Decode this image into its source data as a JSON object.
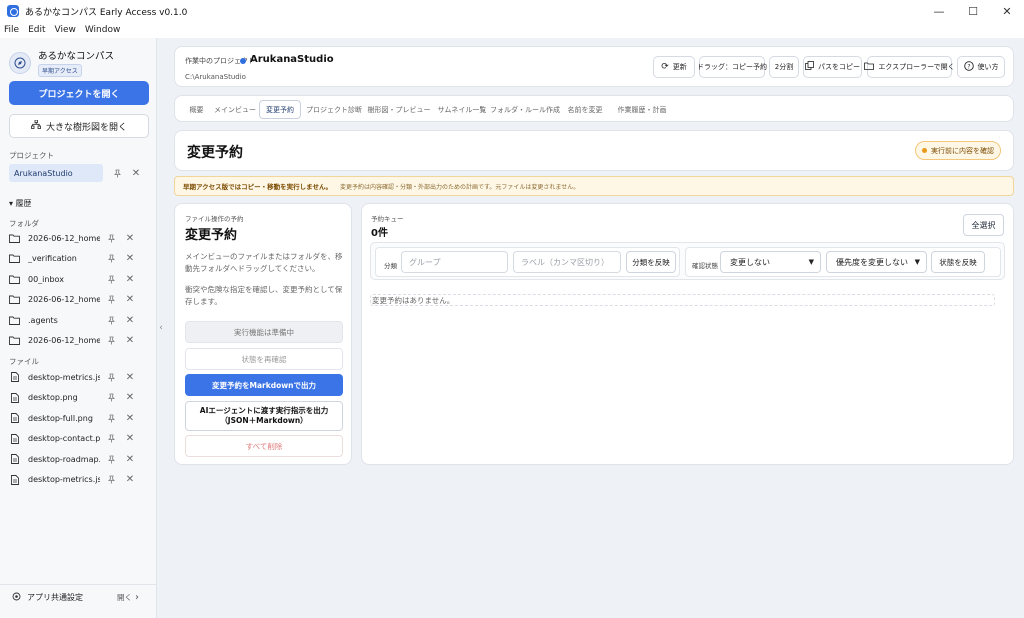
{
  "window": {
    "title": "あるかなコンパス Early Access v0.1.0",
    "controls": [
      "—",
      "☐",
      "✕"
    ]
  },
  "menu": [
    "File",
    "Edit",
    "View",
    "Window"
  ],
  "sidebar": {
    "brand_name": "あるかなコンパス",
    "brand_badge": "早期アクセス",
    "open_project_label": "プロジェクトを開く",
    "big_tree_label": "大きな樹形図を開く",
    "project_section": "プロジェクト",
    "project_name": "ArukanaStudio",
    "history_label": "▾ 履歴",
    "folder_section": "フォルダ",
    "folders": [
      {
        "name": "2026-06-12_home..."
      },
      {
        "name": "_verification"
      },
      {
        "name": "00_inbox"
      },
      {
        "name": "2026-06-12_home..."
      },
      {
        "name": ".agents"
      },
      {
        "name": "2026-06-12_home..."
      }
    ],
    "file_section": "ファイル",
    "files": [
      {
        "name": "desktop-metrics.js..."
      },
      {
        "name": "desktop.png"
      },
      {
        "name": "desktop-full.png"
      },
      {
        "name": "desktop-contact.p..."
      },
      {
        "name": "desktop-roadmap..."
      },
      {
        "name": "desktop-metrics.js..."
      }
    ],
    "settings_label": "アプリ共通設定",
    "settings_open": "開く"
  },
  "header": {
    "current_label": "作業中のプロジェクト",
    "project_name": "ArukanaStudio",
    "project_path": "C:\\ArukanaStudio",
    "buttons": {
      "refresh": "更新",
      "drag_mode": "ドラッグ：コピー予約",
      "split": "2分割",
      "copy_path": "パスをコピー",
      "open_explorer": "エクスプローラーで開く",
      "help": "使い方"
    }
  },
  "tabs": [
    {
      "label": "概要"
    },
    {
      "label": "メインビュー"
    },
    {
      "label": "変更予約"
    },
    {
      "label": "プロジェクト診断"
    },
    {
      "label": "樹形図・プレビュー"
    },
    {
      "label": "サムネイル一覧"
    },
    {
      "label": "フォルダ・ルール作成"
    },
    {
      "label": "名前を変更"
    },
    {
      "label": "作業履歴・計画"
    }
  ],
  "active_tab_index": 2,
  "page": {
    "title": "変更予約",
    "warn_pill": "実行前に内容を確認"
  },
  "banner": {
    "strong": "早期アクセス版ではコピー・移動を実行しません。",
    "sub": "変更予約は内容確認・分類・外部出力のための計画です。元ファイルは変更されません。"
  },
  "left_panel": {
    "eyebrow": "ファイル操作の予約",
    "title": "変更予約",
    "desc1": "メインビューのファイルまたはフォルダを、移動先フォルダへドラッグしてください。",
    "desc2": "衝突や危険な指定を確認し、変更予約として保存します。",
    "btn_execute": "実行機能は準備中",
    "btn_recheck": "状態を再確認",
    "btn_markdown": "変更予約をMarkdownで出力",
    "btn_ai_line1": "AIエージェントに渡す実行指示を出力",
    "btn_ai_line2": "（JSON＋Markdown）",
    "btn_clear": "すべて削除"
  },
  "right_panel": {
    "eyebrow": "予約キュー",
    "count": "0件",
    "select_all": "全選択",
    "category_label": "分類",
    "group_placeholder": "グループ",
    "label_placeholder": "ラベル（カンマ区切り）",
    "apply_category": "分類を反映",
    "status_label": "確認状態",
    "status_select": "変更しない",
    "priority_select": "優先度を変更しない",
    "apply_status": "状態を反映",
    "empty": "変更予約はありません。"
  }
}
